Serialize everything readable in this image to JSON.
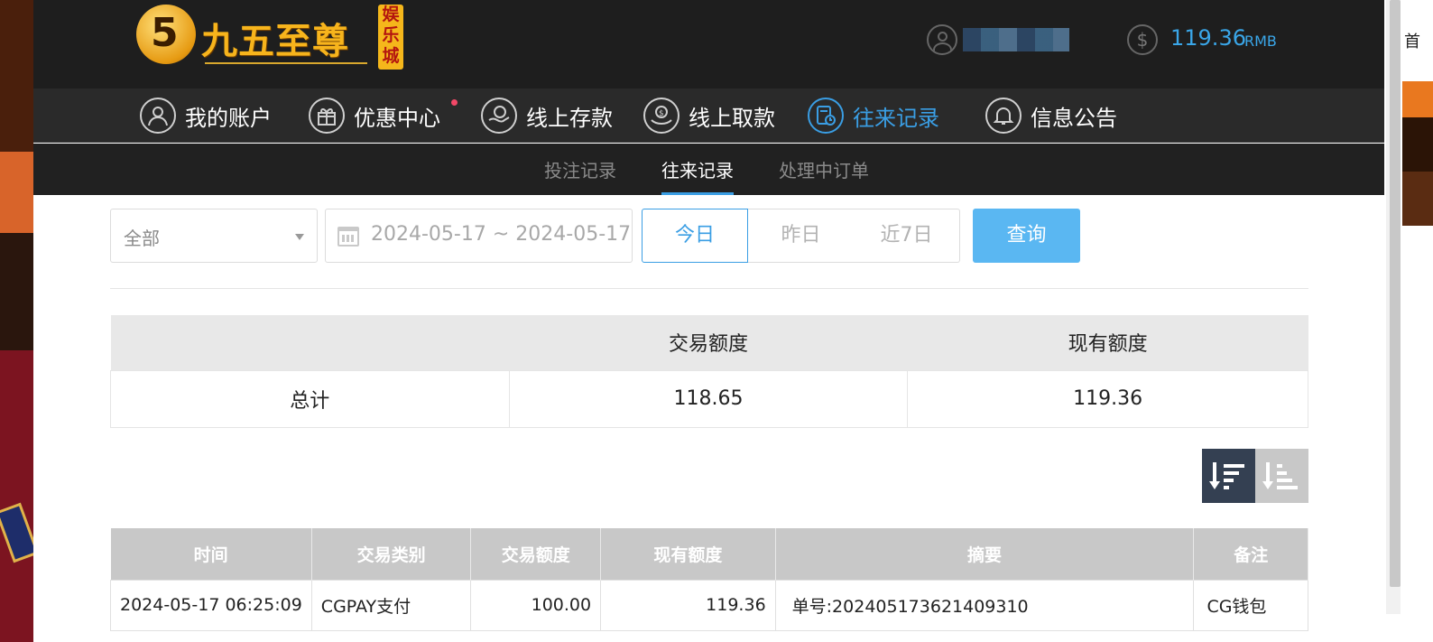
{
  "header": {
    "logo_text": "九五至尊",
    "logo_badge": "娱乐城",
    "logo_mark": "5",
    "balance": "119.36",
    "balance_unit": "RMB",
    "user_icon": "user-circle-icon",
    "balance_icon": "dollar-coin-icon"
  },
  "nav": {
    "items": [
      {
        "label": "我的账户",
        "icon": "user-icon"
      },
      {
        "label": "优惠中心",
        "icon": "gift-icon"
      },
      {
        "label": "线上存款",
        "icon": "deposit-icon"
      },
      {
        "label": "线上取款",
        "icon": "withdraw-icon"
      },
      {
        "label": "往来记录",
        "icon": "records-icon"
      },
      {
        "label": "信息公告",
        "icon": "bell-icon"
      }
    ],
    "active_index": 4
  },
  "subnav": {
    "tabs": [
      {
        "label": "投注记录"
      },
      {
        "label": "往来记录"
      },
      {
        "label": "处理中订单"
      }
    ],
    "active_index": 1
  },
  "filters": {
    "type_select": "全部",
    "date_range": "2024-05-17 ~ 2024-05-17",
    "quick": {
      "today": "今日",
      "yesterday": "昨日",
      "week": "近7日"
    },
    "query_label": "查询"
  },
  "summary": {
    "headers": [
      "",
      "交易额度",
      "现有额度"
    ],
    "row": {
      "label": "总计",
      "trade": "118.65",
      "current": "119.36"
    }
  },
  "records": {
    "headers": [
      "时间",
      "交易类别",
      "交易额度",
      "现有额度",
      "摘要",
      "备注"
    ],
    "rows": [
      {
        "time": "2024-05-17 06:25:09",
        "type": "CGPAY支付",
        "amount": "100.00",
        "current": "119.36",
        "summary": "单号:202405173621409310",
        "note": "CG钱包"
      }
    ]
  },
  "right_edge_text": "首",
  "colors": {
    "accent": "#3a9ee4",
    "query_button": "#5ab7f2",
    "topbar": "#1e1e1e"
  }
}
